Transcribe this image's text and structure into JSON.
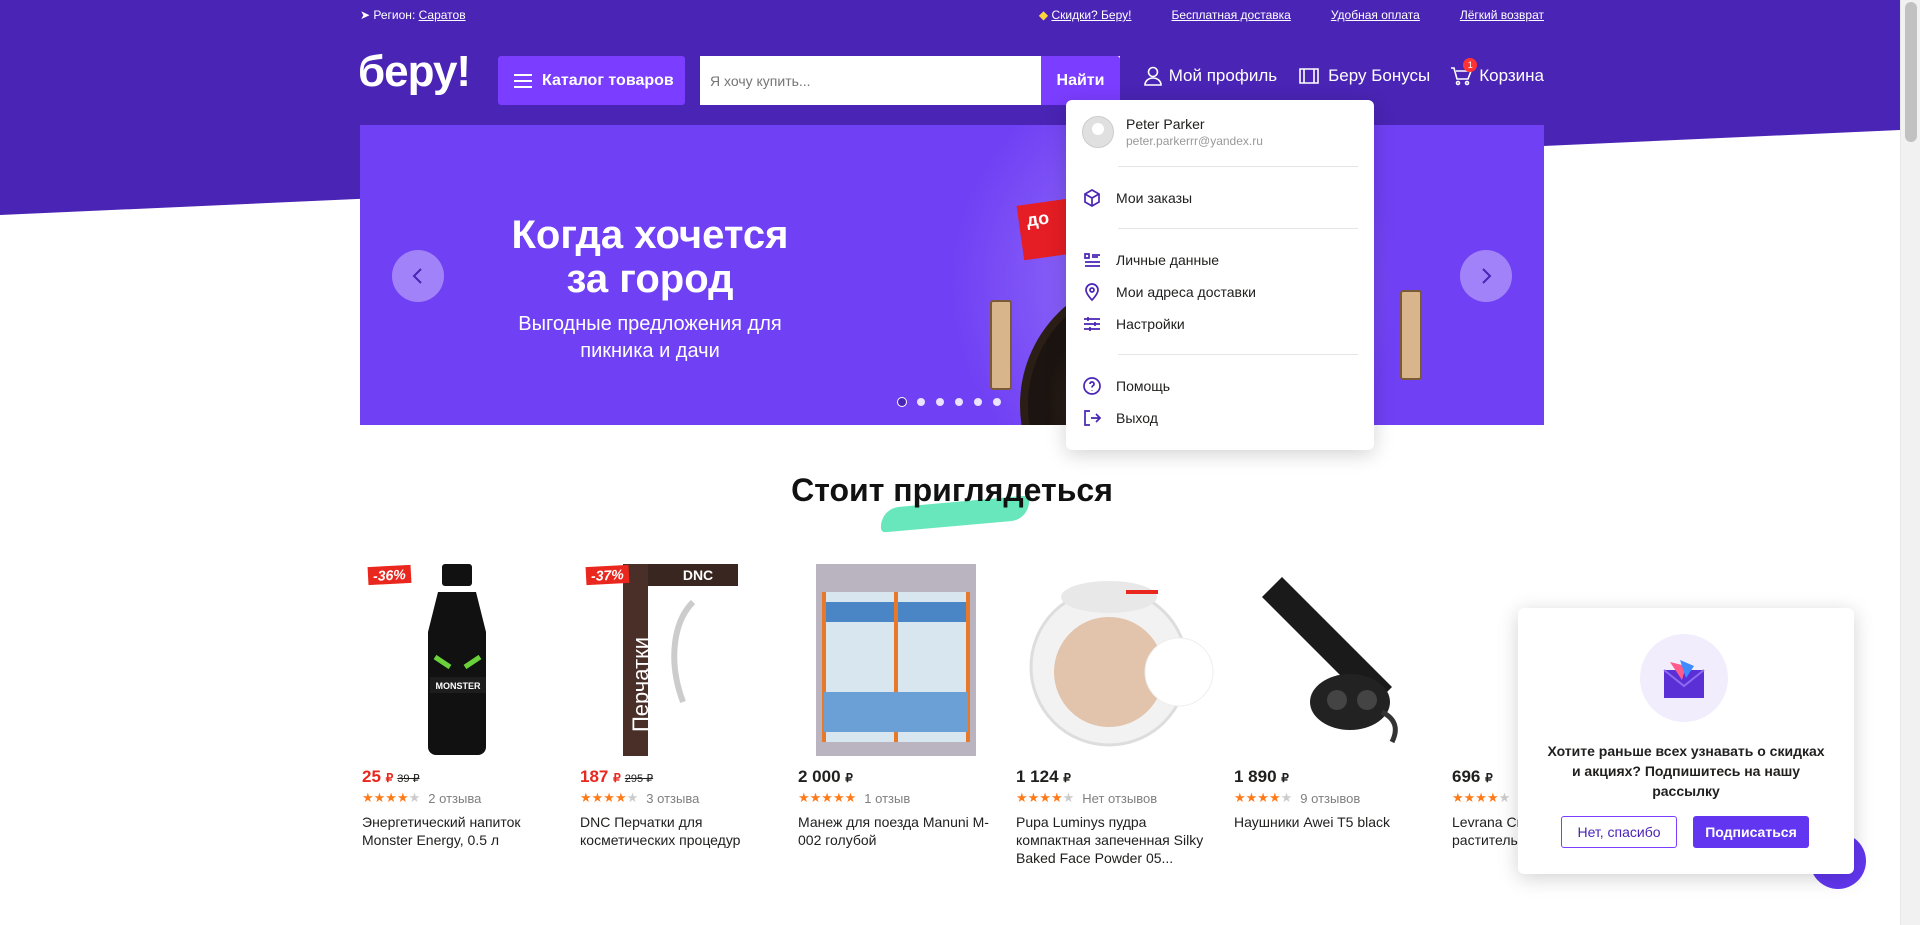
{
  "topbar": {
    "region_label": "Регион:",
    "region_value": "Саратов",
    "promo_label": "Скидки? Беру!",
    "links": [
      "Бесплатная доставка",
      "Удобная оплата",
      "Лёгкий возврат"
    ]
  },
  "header": {
    "logo": "беру!",
    "catalog_label": "Каталог товаров",
    "search_placeholder": "Я хочу купить...",
    "search_button": "Найти",
    "profile_label": "Мой профиль",
    "bonus_label": "Беру Бонусы",
    "cart_label": "Корзина",
    "cart_count": "1"
  },
  "banner": {
    "title": "Когда хочется за город",
    "subtitle": "Выгодные предложения для пикника и дачи",
    "tag": "до",
    "slides_total": 6,
    "active_slide": 1
  },
  "dropdown": {
    "user_name": "Peter Parker",
    "user_email": "peter.parkerrr@yandex.ru",
    "items": [
      {
        "label": "Мои заказы",
        "icon": "box-icon"
      },
      {
        "label": "Личные данные",
        "icon": "list-icon"
      },
      {
        "label": "Мои адреса доставки",
        "icon": "pin-icon"
      },
      {
        "label": "Настройки",
        "icon": "sliders-icon"
      },
      {
        "label": "Помощь",
        "icon": "help-icon"
      },
      {
        "label": "Выход",
        "icon": "logout-icon"
      }
    ]
  },
  "section": {
    "title": "Стоит приглядеться"
  },
  "products": [
    {
      "badge": "-36%",
      "price": "25",
      "currency": "₽",
      "old_price": "39 ₽",
      "sale": true,
      "rating": 4,
      "reviews": "2 отзыва",
      "title": "Энергетический напиток Monster Energy, 0.5 л"
    },
    {
      "badge": "-37%",
      "price": "187",
      "currency": "₽",
      "old_price": "295 ₽",
      "sale": true,
      "rating": 4.5,
      "reviews": "3 отзыва",
      "title": "DNC Перчатки для косметических процедур"
    },
    {
      "badge": "",
      "price": "2 000",
      "currency": "₽",
      "old_price": "",
      "sale": false,
      "rating": 5,
      "reviews": "1 отзыв",
      "title": "Манеж для поезда Manuni M-002 голубой"
    },
    {
      "badge": "",
      "price": "1 124",
      "currency": "₽",
      "old_price": "",
      "sale": false,
      "rating": 4.5,
      "reviews": "Нет отзывов",
      "title": "Pupa Luminys пудра компактная запеченная Silky Baked Face Powder 05..."
    },
    {
      "badge": "",
      "price": "1 890",
      "currency": "₽",
      "old_price": "",
      "sale": false,
      "rating": 4,
      "reviews": "9 отзывов",
      "title": "Наушники Awei T5 black"
    },
    {
      "badge": "",
      "price": "696",
      "currency": "₽",
      "old_price": "",
      "sale": false,
      "rating": 4.5,
      "reviews": "",
      "title": "Levrana Сы... 100% нату... раститель..."
    }
  ],
  "subscribe": {
    "text": "Хотите раньше всех узнавать о скидках и акциях? Подпишитесь на нашу рассылку",
    "no_label": "Нет, спасибо",
    "yes_label": "Подписаться"
  },
  "colors": {
    "brand_purple": "#4a24b5",
    "accent_purple": "#7b3dff",
    "sale_red": "#e9271e",
    "star_orange": "#ff7b1a"
  }
}
